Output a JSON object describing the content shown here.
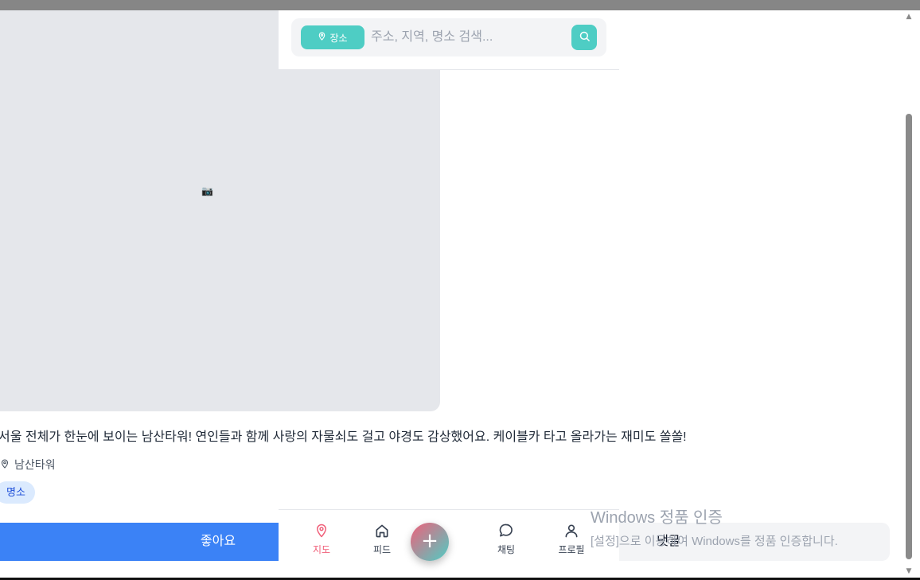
{
  "post": {
    "image_placeholder_glyph": "📷",
    "text": "서울 전체가 한눈에 보이는 남산타워! 연인들과 함께 사랑의 자물쇠도 걸고 야경도 감상했어요. 케이블카 타고 올라가는 재미도 쏠쏠!",
    "location": "남산타워",
    "tag": "명소",
    "like_label": "좋아요",
    "comment_label": "댓글"
  },
  "search": {
    "chip_label": "장소",
    "placeholder": "주소, 지역, 명소 검색..."
  },
  "nav": {
    "items": [
      {
        "label": "지도",
        "icon": "map-pin-icon",
        "active": true
      },
      {
        "label": "피드",
        "icon": "home-icon",
        "active": false
      },
      {
        "label": "채팅",
        "icon": "chat-bubble-icon",
        "active": false
      },
      {
        "label": "프로필",
        "icon": "user-icon",
        "active": false
      }
    ],
    "fab_symbol": "+"
  },
  "watermark": {
    "title": "Windows 정품 인증",
    "subtitle": "[설정]으로 이동하여 Windows를 정품 인증합니다."
  },
  "colors": {
    "accent": "#4ecdc4",
    "active_nav": "#f0607a",
    "like_button": "#3b82f6",
    "tag_bg": "#dbeafe"
  }
}
